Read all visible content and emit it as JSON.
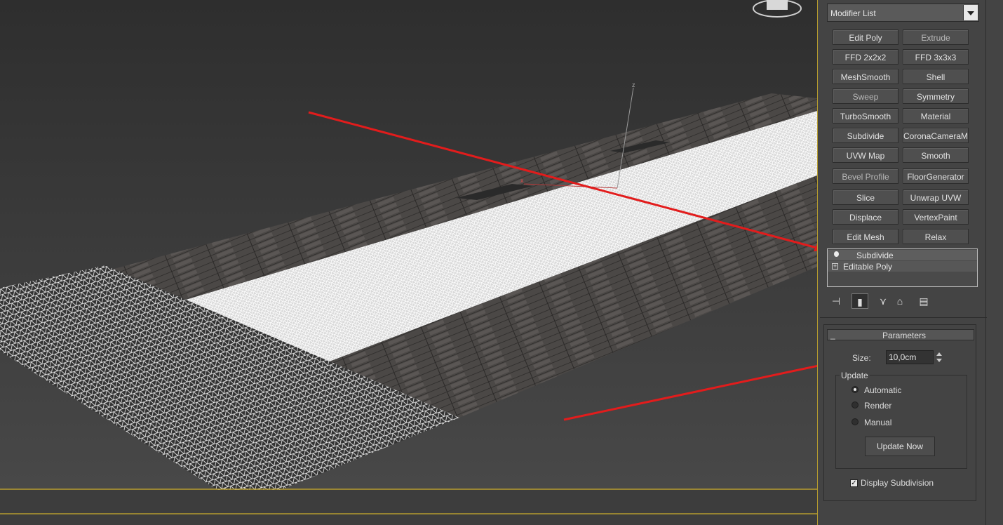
{
  "modifier_list": {
    "label": "Modifier List"
  },
  "buttons": [
    [
      "Edit Poly",
      "Extrude"
    ],
    [
      "FFD 2x2x2",
      "FFD 3x3x3"
    ],
    [
      "MeshSmooth",
      "Shell"
    ],
    [
      "Sweep",
      "Symmetry"
    ],
    [
      "TurboSmooth",
      "Material"
    ],
    [
      "Subdivide",
      "CoronaCameraMod"
    ],
    [
      "UVW Map",
      "Smooth"
    ],
    [
      "Bevel Profile",
      "FloorGenerator"
    ],
    [
      "Slice",
      "Unwrap UVW"
    ],
    [
      "Displace",
      "VertexPaint"
    ],
    [
      "Edit Mesh",
      "Relax"
    ]
  ],
  "stack": [
    {
      "label": "Subdivide",
      "icon": "lightbulb-icon"
    },
    {
      "label": "Editable Poly",
      "icon": "expand-plus-icon"
    }
  ],
  "parameters": {
    "title": "Parameters",
    "collapse": "_",
    "size_label": "Size:",
    "size_value": "10,0cm",
    "update_label": "Update",
    "options": [
      "Automatic",
      "Render",
      "Manual"
    ],
    "selected": "Automatic",
    "update_now": "Update Now",
    "display_subdivision": "Display Subdivision",
    "display_subdivision_checked": true
  },
  "viewport": {
    "axis_z": "z",
    "axis_x": "x"
  },
  "colors": {
    "arrow": "#e21c1c",
    "border_highlight": "#b59b2e"
  }
}
